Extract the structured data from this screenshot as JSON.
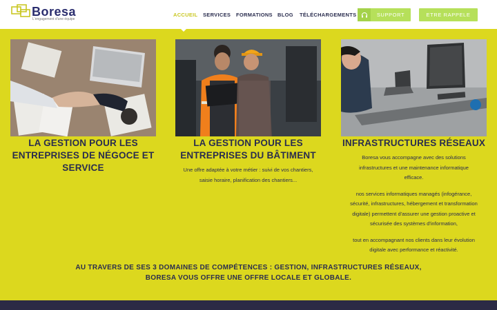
{
  "brand": {
    "name": "Boresa",
    "tagline": "L'engagement d'une équipe"
  },
  "nav": {
    "items": [
      {
        "label": "ACCUEIL",
        "active": true
      },
      {
        "label": "SERVICES",
        "active": false
      },
      {
        "label": "FORMATIONS",
        "active": false
      },
      {
        "label": "BLOG",
        "active": false
      },
      {
        "label": "TÉLÉCHARGEMENTS",
        "active": false
      }
    ],
    "support_label": "SUPPORT",
    "callback_label": "ETRE RAPPELE"
  },
  "colors": {
    "accent": "#dcd81e",
    "button": "#b6e05a",
    "navy": "#2a2d4e",
    "footer": "#2b2a45"
  },
  "cards": [
    {
      "image": "handshake-office-photo",
      "title": [
        "LA GESTION POUR LES",
        "ENTREPRISES DE NÉGOCE ET",
        "SERVICE"
      ],
      "description": []
    },
    {
      "image": "construction-workers-laptop-photo",
      "title": [
        "LA GESTION POUR LES",
        "ENTREPRISES DU BÂTIMENT"
      ],
      "description": [
        "Une offre adaptée à votre métier : suivi de vos chantiers,",
        "saisie horaire, planification des chantiers..."
      ]
    },
    {
      "image": "it-workstation-photo",
      "title": [
        "INFRASTRUCTURES RÉSEAUX"
      ],
      "description": [
        "Boresa vous accompagne avec des solutions",
        "infrastructures et une maintenance informatique",
        "efficace.",
        "nos services informatiques managés (infogérance,",
        "sécurité, infrastructures, hébergement et transformation",
        "digitale) permettent d'assurer une gestion proactive et",
        "sécurisée des systèmes d'information,",
        "tout en accompagnant nos clients dans leur évolution",
        "digitale avec performance et réactivité."
      ]
    }
  ],
  "summary": [
    "AU TRAVERS DE SES 3 DOMAINES DE COMPÉTENCES : GESTION, INFRASTRUCTURES RÉSEAUX,",
    "BORESA VOUS OFFRE UNE OFFRE LOCALE ET GLOBALE."
  ]
}
